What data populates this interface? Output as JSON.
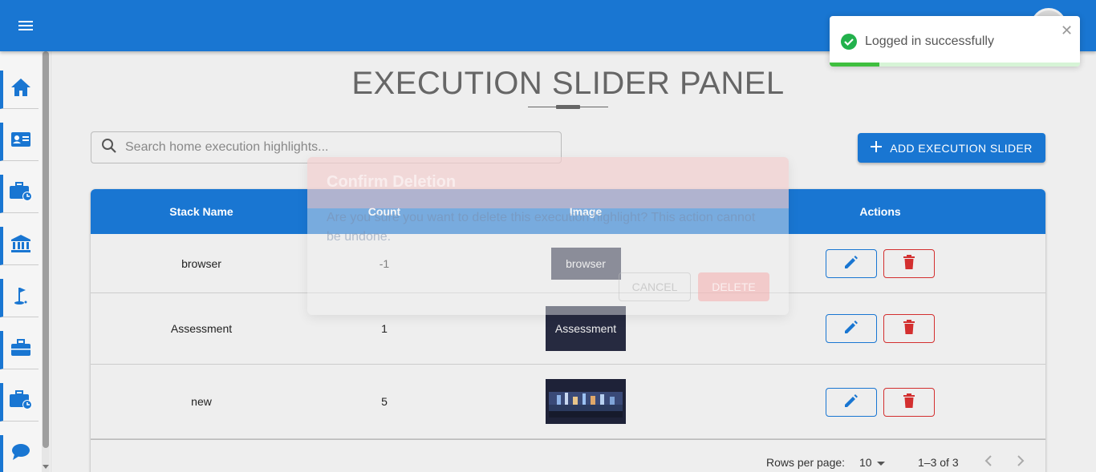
{
  "colors": {
    "primary": "#1976d2",
    "danger": "#d32f2f",
    "success": "#3fbf3f"
  },
  "topbar": {
    "menu_icon": "hamburger-menu-icon"
  },
  "sidebar": {
    "items": [
      {
        "icon": "home-icon"
      },
      {
        "icon": "id-card-icon"
      },
      {
        "icon": "briefcase-clock-icon"
      },
      {
        "icon": "bank-icon"
      },
      {
        "icon": "golf-flag-icon"
      },
      {
        "icon": "briefcase-icon"
      },
      {
        "icon": "briefcase-clock-icon"
      },
      {
        "icon": "chat-bubble-icon"
      }
    ]
  },
  "page": {
    "title": "EXECUTION SLIDER PANEL"
  },
  "search": {
    "placeholder": "Search home execution highlights..."
  },
  "add_button": {
    "label": "ADD EXECUTION SLIDER"
  },
  "table": {
    "columns": [
      "Stack Name",
      "Count",
      "Image",
      "Actions"
    ],
    "rows": [
      {
        "stack_name": "browser",
        "count": "-1",
        "image_alt": "browser"
      },
      {
        "stack_name": "Assessment",
        "count": "1",
        "image_alt": "Assessment"
      },
      {
        "stack_name": "new",
        "count": "5",
        "image_alt": ""
      }
    ]
  },
  "pagination": {
    "rows_per_page_label": "Rows per page:",
    "rows_per_page": "10",
    "range": "1–3 of 3"
  },
  "dialog": {
    "title": "Confirm Deletion",
    "message": "Are you sure you want to delete this execution highlight? This action cannot be undone.",
    "cancel_label": "CANCEL",
    "delete_label": "DELETE"
  },
  "toast": {
    "message": "Logged in successfully",
    "progress": 0.2
  }
}
